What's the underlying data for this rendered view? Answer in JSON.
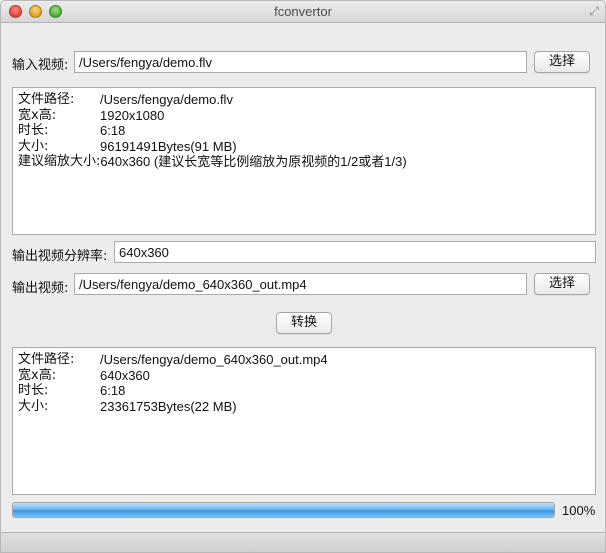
{
  "window": {
    "title": "fconvertor"
  },
  "input": {
    "label": "输入视频:",
    "path": "/Users/fengya/demo.flv",
    "choose_label": "选择"
  },
  "input_info": {
    "path_label": "文件路径:",
    "path": "/Users/fengya/demo.flv",
    "size_label": "宽x高:",
    "size": "1920x1080",
    "duration_label": "时长:",
    "duration": "6:18",
    "filesize_label": "大小:",
    "filesize": "96191491Bytes(91 MB)",
    "suggest_label": "建议缩放大小:",
    "suggest": "640x360  (建议长宽等比例缩放为原视频的1/2或者1/3)"
  },
  "resolution": {
    "label": "输出视频分辨率:",
    "value": "640x360"
  },
  "output": {
    "label": "输出视频:",
    "path": "/Users/fengya/demo_640x360_out.mp4",
    "choose_label": "选择"
  },
  "convert": {
    "label": "转换"
  },
  "output_info": {
    "path_label": "文件路径:",
    "path": "/Users/fengya/demo_640x360_out.mp4",
    "size_label": "宽x高:",
    "size": "640x360",
    "duration_label": "时长:",
    "duration": "6:18",
    "filesize_label": "大小:",
    "filesize": "23361753Bytes(22 MB)"
  },
  "progress": {
    "value": 1.0,
    "text": "100%"
  },
  "colors": {
    "progress_fill": "#3d97e3",
    "close": "#e0443e",
    "minimize": "#dea123",
    "zoom": "#4fa53a"
  }
}
